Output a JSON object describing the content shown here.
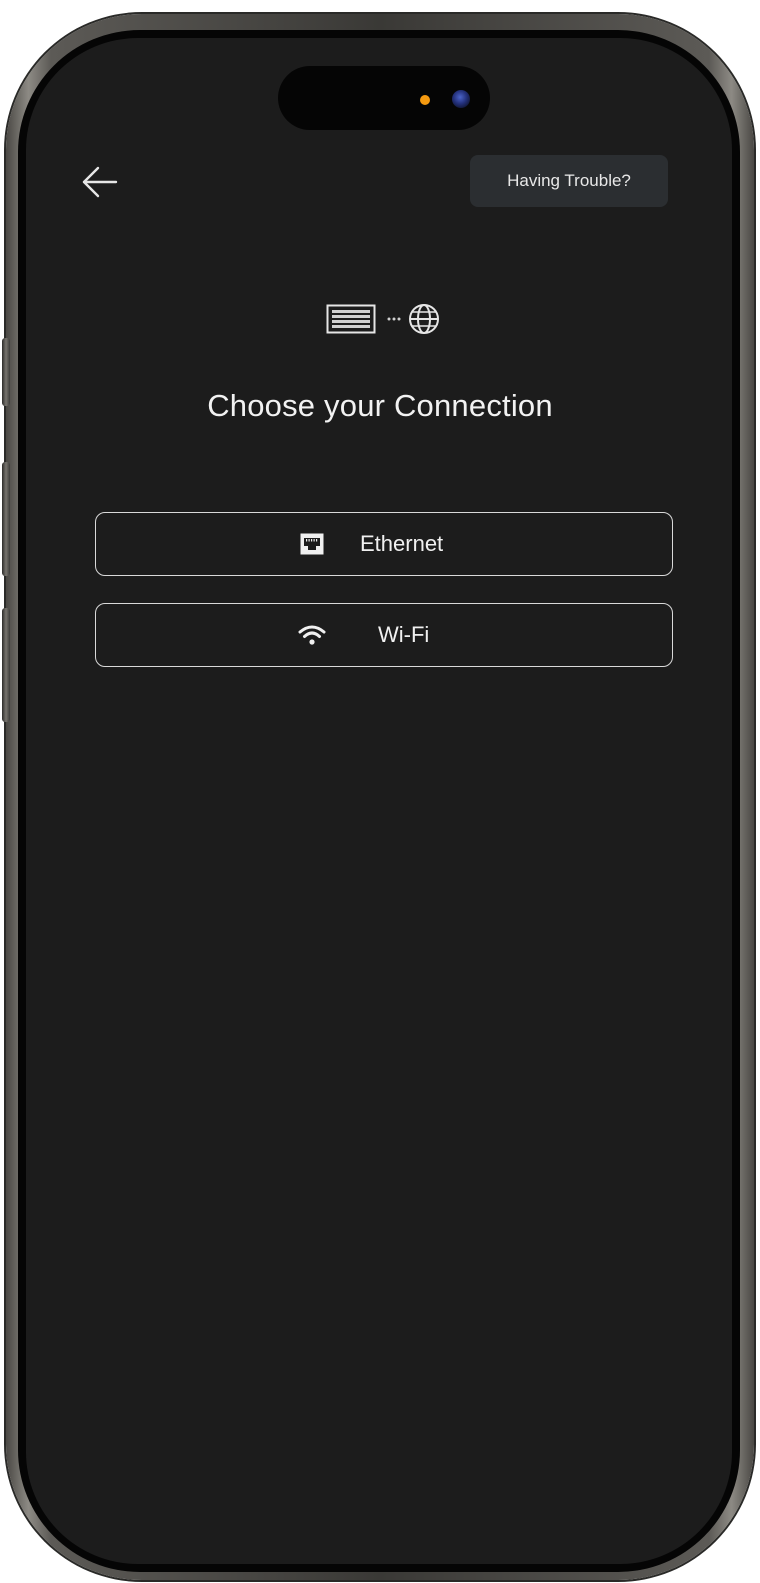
{
  "header": {
    "back_icon": "arrow-left-icon",
    "help_button_label": "Having Trouble?"
  },
  "hero": {
    "icons": [
      "router-icon",
      "dots-icon",
      "globe-icon"
    ]
  },
  "main": {
    "title": "Choose your Connection",
    "options": [
      {
        "label": "Ethernet",
        "icon": "ethernet-port-icon"
      },
      {
        "label": "Wi-Fi",
        "icon": "wifi-icon"
      }
    ]
  },
  "colors": {
    "screen_background": "#1c1c1c",
    "help_button_background": "#2b2e31",
    "text": "#f0f0f0",
    "button_border": "#d9d9d9",
    "camera_indicator": "#f59a10"
  }
}
